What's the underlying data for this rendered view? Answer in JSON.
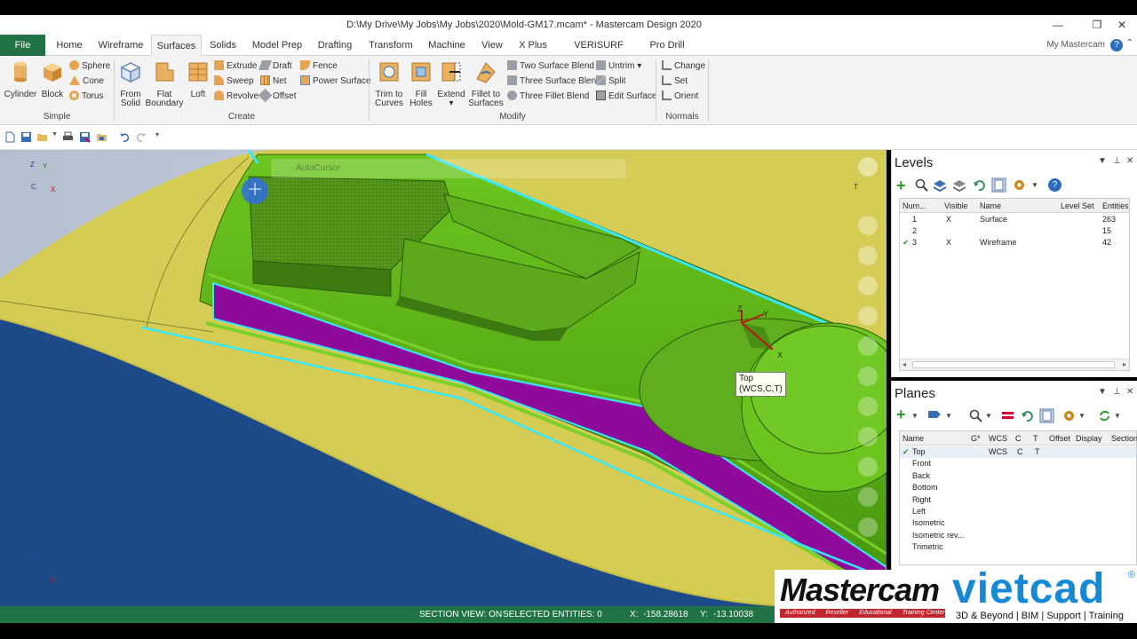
{
  "window": {
    "title": "D:\\My Drive\\My Jobs\\My Jobs\\2020\\Mold-GM17.mcam* - Mastercam Design 2020",
    "minimize": "—",
    "restore": "❐",
    "close": "✕"
  },
  "tabs": [
    "File",
    "Home",
    "Wireframe",
    "Surfaces",
    "Solids",
    "Model Prep",
    "Drafting",
    "Transform",
    "Machine",
    "View",
    "X Plus",
    "VERISURF TOOLS",
    "Pro Drill"
  ],
  "my_mastercam": "My Mastercam",
  "help": "?",
  "collapse": "⌃",
  "ribbon": {
    "simple": {
      "label": "Simple",
      "cylinder": "Cylinder",
      "block": "Block",
      "sphere": "Sphere",
      "cone": "Cone",
      "torus": "Torus"
    },
    "create": {
      "label": "Create",
      "from_solid": [
        "From",
        "Solid"
      ],
      "flat_boundary": [
        "Flat",
        "Boundary"
      ],
      "loft": "Loft",
      "extrude": "Extrude",
      "sweep": "Sweep",
      "revolve": "Revolve",
      "draft": "Draft",
      "net": "Net",
      "offset": "Offset",
      "fence": "Fence",
      "power_surface": "Power Surface"
    },
    "modify": {
      "label": "Modify",
      "trim_to_curves": [
        "Trim to",
        "Curves"
      ],
      "fill_holes": [
        "Fill",
        "Holes"
      ],
      "extend": "Extend",
      "fillet_to_surfaces": [
        "Fillet to",
        "Surfaces"
      ],
      "two_surface_blend": "Two Surface Blend",
      "three_surface_blend": "Three Surface Blend",
      "three_fillet_blend": "Three Fillet Blend",
      "untrim": "Untrim",
      "split": "Split",
      "edit_surface": "Edit Surface"
    },
    "normals": {
      "label": "Normals",
      "change": "Change",
      "set": "Set",
      "orient": "Orient"
    }
  },
  "viewport": {
    "autocursor": "AutoCursor",
    "plane_tip": [
      "Top",
      "(WCS,C,T)"
    ],
    "gnomon_x": "X",
    "gnomon_y": "Y",
    "gnomon_z": "Z",
    "gnomon_c": "C",
    "gnomon_t": "T"
  },
  "status": {
    "section_view": "SECTION VIEW: ON",
    "selected": "SELECTED ENTITIES: 0",
    "x_label": "X:",
    "x_value": "-158.28618",
    "y_label": "Y:",
    "y_value": "-13.10038"
  },
  "levels": {
    "title": "Levels",
    "columns": [
      "Num...",
      "Visible",
      "Name",
      "Level Set",
      "Entities"
    ],
    "rows": [
      {
        "check": "",
        "num": "1",
        "visible": "X",
        "name": "Surface",
        "set": "",
        "entities": "263"
      },
      {
        "check": "",
        "num": "2",
        "visible": "",
        "name": "",
        "set": "",
        "entities": "15"
      },
      {
        "check": "✔",
        "num": "3",
        "visible": "X",
        "name": "Wireframe",
        "set": "",
        "entities": "42"
      }
    ]
  },
  "planes": {
    "title": "Planes",
    "columns": [
      "Name",
      "G*",
      "WCS",
      "C",
      "T",
      "Offset",
      "Display",
      "Section"
    ],
    "rows": [
      {
        "check": "✔",
        "name": "Top",
        "wcs": "WCS",
        "c": "C",
        "t": "T"
      },
      {
        "check": "",
        "name": "Front",
        "wcs": "",
        "c": "",
        "t": ""
      },
      {
        "check": "",
        "name": "Back",
        "wcs": "",
        "c": "",
        "t": ""
      },
      {
        "check": "",
        "name": "Bottom",
        "wcs": "",
        "c": "",
        "t": ""
      },
      {
        "check": "",
        "name": "Right",
        "wcs": "",
        "c": "",
        "t": ""
      },
      {
        "check": "",
        "name": "Left",
        "wcs": "",
        "c": "",
        "t": ""
      },
      {
        "check": "",
        "name": "Isometric",
        "wcs": "",
        "c": "",
        "t": ""
      },
      {
        "check": "",
        "name": "Isometric rev...",
        "wcs": "",
        "c": "",
        "t": ""
      },
      {
        "check": "",
        "name": "Trimetric",
        "wcs": "",
        "c": "",
        "t": ""
      }
    ]
  },
  "panel_controls": {
    "menu": "▼",
    "pin": "⊥",
    "close": "✕"
  },
  "watermark": {
    "mastercam": "Mastercam",
    "sub": [
      "Authorized",
      "Reseller",
      "Educational",
      "Training Center"
    ],
    "vietcad": "vietcad",
    "reg": "®",
    "tagline": "3D & Beyond | BIM | Support | Training"
  }
}
